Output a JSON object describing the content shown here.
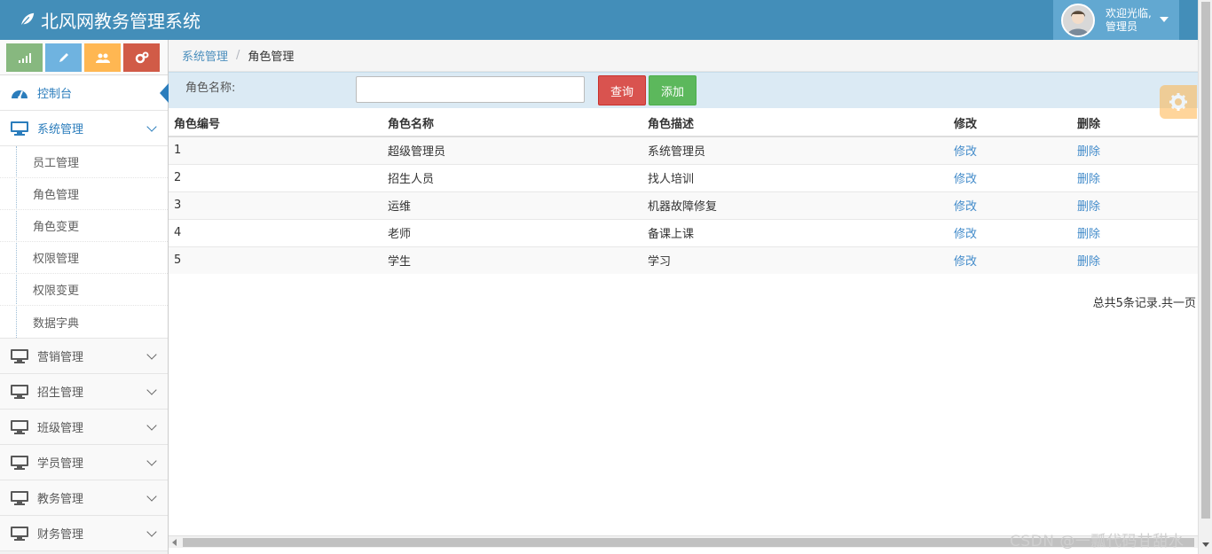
{
  "header": {
    "brand": "北风网教务管理系统",
    "welcome": "欢迎光临,",
    "role": "管理员"
  },
  "sidebar": {
    "dashboard": "控制台",
    "system_mgmt": "系统管理",
    "sub_items": [
      "员工管理",
      "角色管理",
      "角色变更",
      "权限管理",
      "权限变更",
      "数据字典"
    ],
    "groups": [
      "营销管理",
      "招生管理",
      "班级管理",
      "学员管理",
      "教务管理",
      "财务管理"
    ]
  },
  "breadcrumb": {
    "parent": "系统管理",
    "current": "角色管理"
  },
  "search": {
    "label": "角色名称:",
    "value": "",
    "query_label": "查询",
    "add_label": "添加"
  },
  "table": {
    "headers": [
      "角色编号",
      "角色名称",
      "角色描述",
      "修改",
      "删除"
    ],
    "rows": [
      {
        "id": "1",
        "name": "超级管理员",
        "desc": "系统管理员",
        "edit": "修改",
        "del": "删除"
      },
      {
        "id": "2",
        "name": "招生人员",
        "desc": "找人培训",
        "edit": "修改",
        "del": "删除"
      },
      {
        "id": "3",
        "name": "运维",
        "desc": "机器故障修复",
        "edit": "修改",
        "del": "删除"
      },
      {
        "id": "4",
        "name": "老师",
        "desc": "备课上课",
        "edit": "修改",
        "del": "删除"
      },
      {
        "id": "5",
        "name": "学生",
        "desc": "学习",
        "edit": "修改",
        "del": "删除"
      }
    ]
  },
  "pagination": {
    "summary": "总共5条记录.共一页"
  },
  "watermark": "CSDN @一瓢代码甘甜水",
  "colors": {
    "header_bg": "#438eb9",
    "accent": "#2b7dbc",
    "query_btn": "#d9534f",
    "add_btn": "#5cb85c"
  }
}
